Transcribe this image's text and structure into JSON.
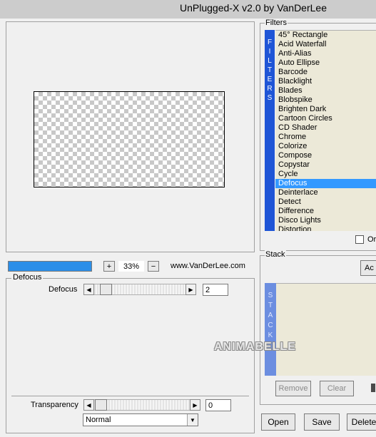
{
  "window": {
    "title": "UnPlugged-X v2.0 by VanDerLee"
  },
  "preview": {
    "zoom_in_label": "+",
    "zoom": "33%",
    "zoom_out_label": "−",
    "website": "www.VanDerLee.com",
    "progress": 1.0
  },
  "params": {
    "group_title": "Defocus",
    "defocus_label": "Defocus",
    "defocus_value": "2",
    "transparency_label": "Transparency",
    "transparency_value": "0",
    "blend_mode": "Normal"
  },
  "filters": {
    "title": "Filters",
    "stripe_letters": [
      "F",
      "I",
      "L",
      "T",
      "E",
      "R",
      "S"
    ],
    "items": [
      "45° Rectangle",
      "Acid Waterfall",
      "Anti-Alias",
      "Auto Ellipse",
      "Barcode",
      "Blacklight",
      "Blades",
      "Blobspike",
      "Brighten Dark",
      "Cartoon Circles",
      "CD Shader",
      "Chrome",
      "Colorize",
      "Compose",
      "Copystar",
      "Cycle",
      "Defocus",
      "Deinterlace",
      "Detect",
      "Difference",
      "Disco Lights",
      "Distortion"
    ],
    "selected": "Defocus",
    "checkbox_label": "Or"
  },
  "stack": {
    "title": "Stack",
    "add_label": "Ac",
    "stripe_letters": [
      "S",
      "T",
      "A",
      "C",
      "K"
    ],
    "remove_label": "Remove",
    "clear_label": "Clear",
    "watermark": "ANIMABELLE"
  },
  "bottom": {
    "open_label": "Open",
    "save_label": "Save",
    "delete_label": "Delete"
  },
  "colors": {
    "selection": "#3399ff",
    "filter_stripe": "#1f55d6",
    "stack_stripe": "#6c8ee0",
    "list_bg": "#ece9d8"
  }
}
